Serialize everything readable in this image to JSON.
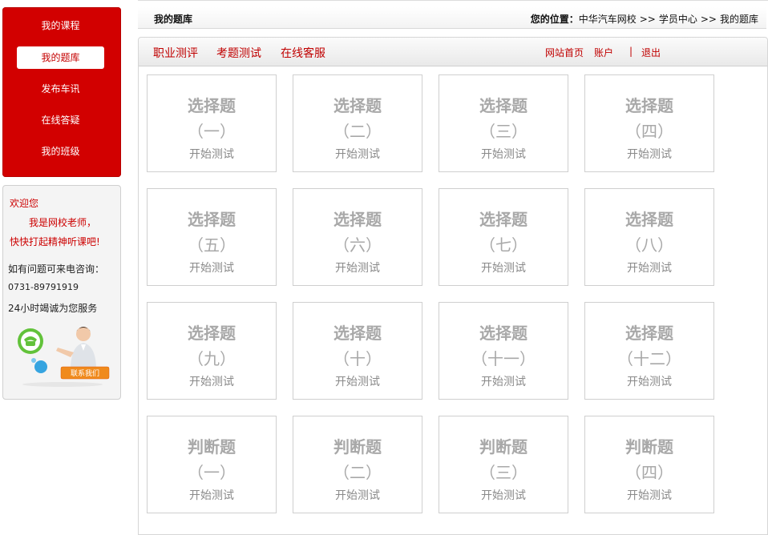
{
  "sidebar": {
    "menu": [
      {
        "label": "我的课程",
        "active": false
      },
      {
        "label": "我的题库",
        "active": true
      },
      {
        "label": "发布车讯",
        "active": false
      },
      {
        "label": "在线答疑",
        "active": false
      },
      {
        "label": "我的班级",
        "active": false
      }
    ],
    "info": {
      "welcome": "欢迎您",
      "line1": "我是网校老师，",
      "line2": "快快打起精神听课吧!",
      "question": "如有问题可来电咨询：",
      "phone": "0731-89791919",
      "service": "24小时竭诚为您服务",
      "contact_badge": "联系我们"
    }
  },
  "header": {
    "title": "我的题库",
    "location_label": "您的位置：",
    "breadcrumbs": [
      "中华汽车网校",
      "学员中心",
      "我的题库"
    ],
    "separator": ">>"
  },
  "tabs": [
    "职业测评",
    "考题测试",
    "在线客服"
  ],
  "top_links": {
    "home": "网站首页",
    "account": "账户",
    "divider": "|",
    "logout": "退出"
  },
  "cards": [
    {
      "type": "选择题",
      "num": "（一）",
      "action": "开始测试"
    },
    {
      "type": "选择题",
      "num": "（二）",
      "action": "开始测试"
    },
    {
      "type": "选择题",
      "num": "（三）",
      "action": "开始测试"
    },
    {
      "type": "选择题",
      "num": "（四）",
      "action": "开始测试"
    },
    {
      "type": "选择题",
      "num": "（五）",
      "action": "开始测试"
    },
    {
      "type": "选择题",
      "num": "（六）",
      "action": "开始测试"
    },
    {
      "type": "选择题",
      "num": "（七）",
      "action": "开始测试"
    },
    {
      "type": "选择题",
      "num": "（八）",
      "action": "开始测试"
    },
    {
      "type": "选择题",
      "num": "（九）",
      "action": "开始测试"
    },
    {
      "type": "选择题",
      "num": "（十）",
      "action": "开始测试"
    },
    {
      "type": "选择题",
      "num": "（十一）",
      "action": "开始测试"
    },
    {
      "type": "选择题",
      "num": "（十二）",
      "action": "开始测试"
    },
    {
      "type": "判断题",
      "num": "（一）",
      "action": "开始测试"
    },
    {
      "type": "判断题",
      "num": "（二）",
      "action": "开始测试"
    },
    {
      "type": "判断题",
      "num": "（三）",
      "action": "开始测试"
    },
    {
      "type": "判断题",
      "num": "（四）",
      "action": "开始测试"
    }
  ],
  "colors": {
    "brand_red": "#d20000",
    "link_red": "#c00000",
    "card_text": "#a8a8a8"
  }
}
